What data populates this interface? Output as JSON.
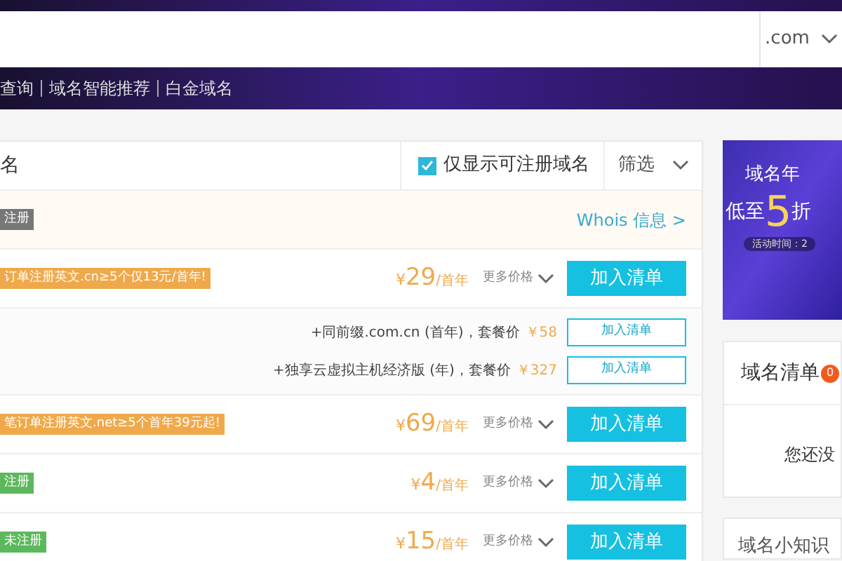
{
  "search": {
    "suffix": ".com"
  },
  "nav_links": [
    "查询",
    "域名智能推荐",
    "白金域名"
  ],
  "results_header": {
    "title": "名",
    "only_available": {
      "label": "仅显示可注册域名",
      "checked": true
    },
    "filter": "筛选"
  },
  "rows": [
    {
      "kind": "registered",
      "tag": "注册",
      "whois": "Whois 信息 >"
    },
    {
      "kind": "promo",
      "tag": "订单注册英文.cn≥5个仅13元/首年!",
      "currency": "¥",
      "price": "29",
      "unit": "/首年",
      "more": "更多价格",
      "button": "加入清单",
      "bundles": [
        {
          "text": "+同前缀.com.cn (首年)，套餐价",
          "price": "￥58",
          "button": "加入清单"
        },
        {
          "text": "+独享云虚拟主机经济版 (年)，套餐价",
          "price": "￥327",
          "button": "加入清单"
        }
      ]
    },
    {
      "kind": "promo",
      "tag": "笔订单注册英文.net≥5个首年39元起!",
      "currency": "¥",
      "price": "69",
      "unit": "/首年",
      "more": "更多价格",
      "button": "加入清单"
    },
    {
      "kind": "available",
      "tag": "注册",
      "currency": "¥",
      "price": "4",
      "unit": "/首年",
      "more": "更多价格",
      "button": "加入清单"
    },
    {
      "kind": "available",
      "tag": "未注册",
      "currency": "¥",
      "price": "15",
      "unit": "/首年",
      "more": "更多价格",
      "button": "加入清单"
    }
  ],
  "promo_banner": {
    "title": "域名年",
    "headline_pre": "低至",
    "headline_num": "5",
    "headline_post": "折",
    "note": "活动时间：2"
  },
  "cart": {
    "title": "域名清单",
    "count": "0",
    "empty": "您还没"
  },
  "tips": {
    "title": "域名小知识"
  }
}
